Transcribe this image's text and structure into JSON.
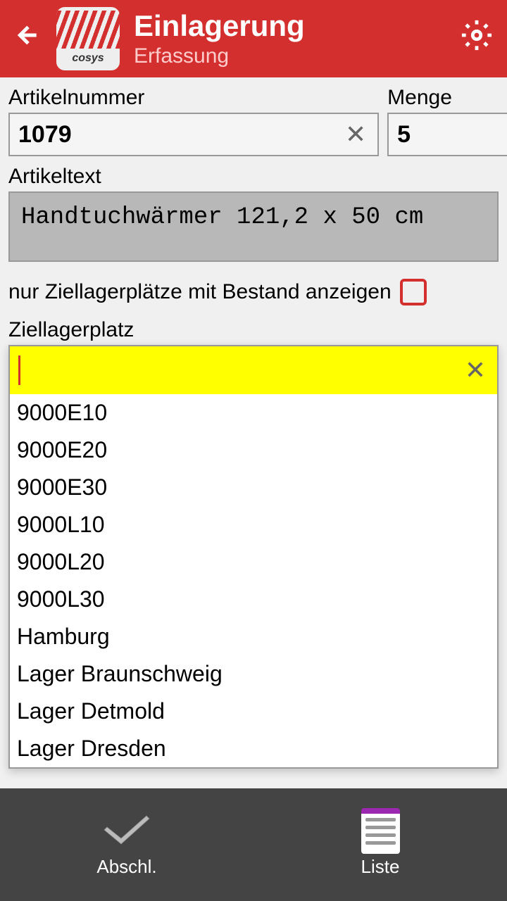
{
  "header": {
    "title": "Einlagerung",
    "subtitle": "Erfassung",
    "logo_text": "cosys"
  },
  "form": {
    "article_number_label": "Artikelnummer",
    "article_number_value": "1079",
    "quantity_label": "Menge",
    "quantity_value": "5",
    "article_text_label": "Artikeltext",
    "article_text_value": "Handtuchwärmer 121,2 x 50 cm",
    "checkbox_label": "nur Ziellagerplätze mit Bestand anzeigen",
    "target_location_label": "Ziellagerplatz",
    "target_location_value": ""
  },
  "locations": [
    "9000E10",
    "9000E20",
    "9000E30",
    "9000L10",
    "9000L20",
    "9000L30",
    "Hamburg",
    "Lager Braunschweig",
    "Lager Detmold",
    "Lager Dresden"
  ],
  "footer": {
    "complete_label": "Abschl.",
    "list_label": "Liste"
  }
}
